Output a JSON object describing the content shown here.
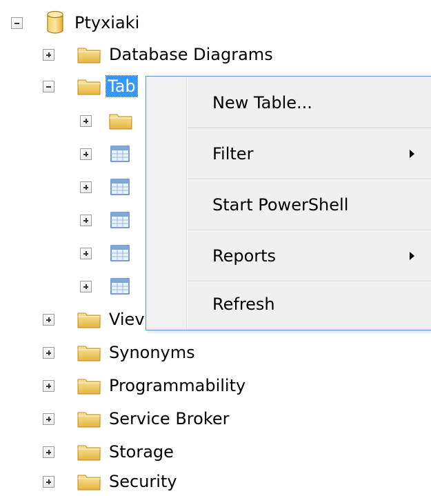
{
  "tree": {
    "root": {
      "label": "Ptyxiaki",
      "icon": "database-icon",
      "expanded": true
    },
    "nodes": [
      {
        "label": "Database Diagrams",
        "icon": "folder-icon",
        "expanded": false
      },
      {
        "label": "Tables",
        "visible_label": "Tab",
        "icon": "folder-icon",
        "expanded": true,
        "selected": true
      },
      {
        "label": "",
        "icon": "folder-icon",
        "expanded": false
      },
      {
        "label": "",
        "icon": "table-icon",
        "expanded": false
      },
      {
        "label": "",
        "icon": "table-icon",
        "expanded": false
      },
      {
        "label": "",
        "icon": "table-icon",
        "expanded": false
      },
      {
        "label": "",
        "icon": "table-icon",
        "expanded": false
      },
      {
        "label": "",
        "icon": "table-icon",
        "expanded": false
      },
      {
        "label": "Views",
        "visible_label": "Viev",
        "icon": "folder-icon",
        "expanded": false
      },
      {
        "label": "Synonyms",
        "icon": "folder-icon",
        "expanded": false
      },
      {
        "label": "Programmability",
        "icon": "folder-icon",
        "expanded": false
      },
      {
        "label": "Service Broker",
        "icon": "folder-icon",
        "expanded": false
      },
      {
        "label": "Storage",
        "icon": "folder-icon",
        "expanded": false
      },
      {
        "label": "Security",
        "icon": "folder-icon",
        "expanded": false
      }
    ]
  },
  "context_menu": {
    "items": [
      {
        "label": "New Table...",
        "has_submenu": false
      },
      {
        "label": "Filter",
        "has_submenu": true
      },
      {
        "label": "Start PowerShell",
        "has_submenu": false
      },
      {
        "label": "Reports",
        "has_submenu": true
      },
      {
        "label": "Refresh",
        "has_submenu": false
      }
    ]
  },
  "colors": {
    "selection": "#3399ff",
    "menu_border": "#5f95d6",
    "menu_background": "#f0f0f0",
    "folder": "#f2c64e"
  }
}
